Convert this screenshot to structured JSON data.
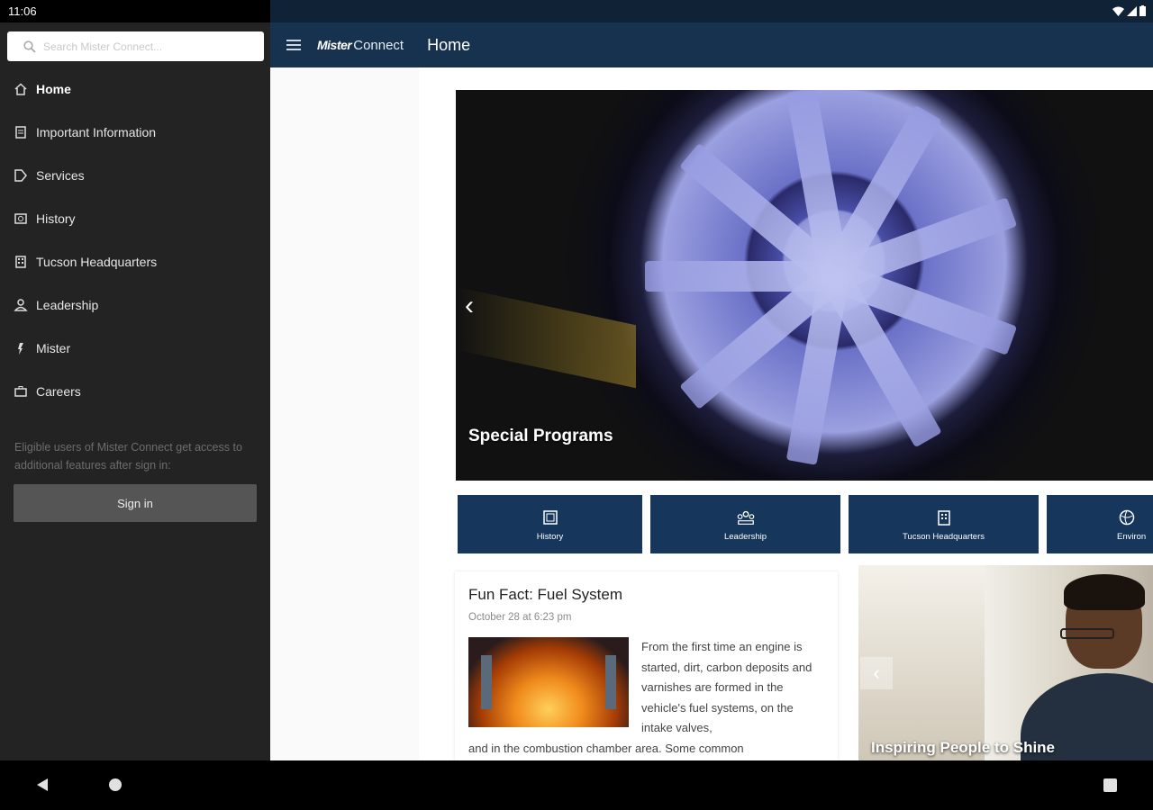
{
  "status": {
    "time": "11:06"
  },
  "drawer": {
    "search_placeholder": "Search Mister Connect...",
    "items": [
      {
        "label": "Home",
        "icon": "home-icon",
        "active": true
      },
      {
        "label": "Important Information",
        "icon": "document-icon"
      },
      {
        "label": "Services",
        "icon": "tag-icon"
      },
      {
        "label": "History",
        "icon": "history-icon"
      },
      {
        "label": "Tucson Headquarters",
        "icon": "building-icon"
      },
      {
        "label": "Leadership",
        "icon": "person-icon"
      },
      {
        "label": "Mister",
        "icon": "mister-icon"
      },
      {
        "label": "Careers",
        "icon": "careers-icon"
      }
    ],
    "note": "Eligible users of Mister Connect get access to additional features after sign in:",
    "signin_label": "Sign in"
  },
  "appbar": {
    "brand_primary": "Mister",
    "brand_secondary": "Connect",
    "title": "Home"
  },
  "hero": {
    "title": "Special Programs"
  },
  "tiles": [
    {
      "label": "History",
      "icon": "history-icon"
    },
    {
      "label": "Leadership",
      "icon": "leadership-icon"
    },
    {
      "label": "Tucson Headquarters",
      "icon": "building-icon"
    },
    {
      "label": "Environ",
      "icon": "globe-icon"
    }
  ],
  "article": {
    "title": "Fun Fact: Fuel System",
    "date": "October 28 at 6:23 pm",
    "text_wrap": "From the first time an engine is started, dirt, carbon deposits and varnishes are formed in the vehicle's fuel systems, on the intake valves,",
    "text_full": "and in the combustion chamber area. Some common"
  },
  "promo": {
    "title": "Inspiring People to Shine"
  },
  "colors": {
    "appbar": "#16324f",
    "drawer": "#232323",
    "tile": "#16365b"
  }
}
